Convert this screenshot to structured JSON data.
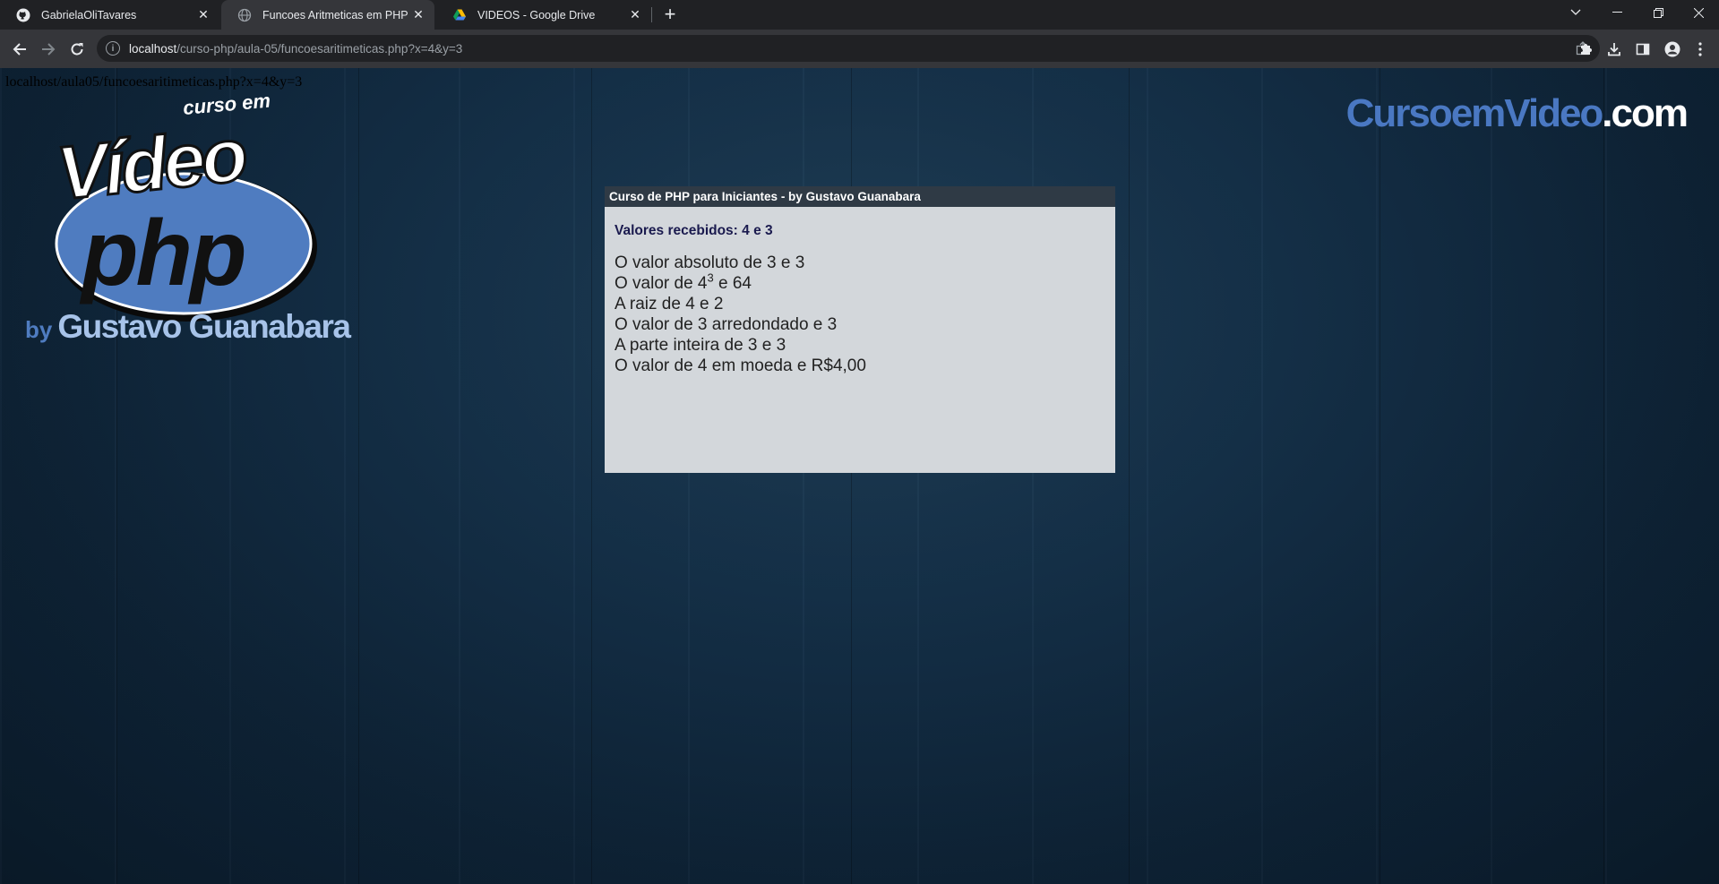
{
  "browser": {
    "tabs": [
      {
        "title": "GabrielaOliTavares",
        "icon": "github-icon",
        "active": false
      },
      {
        "title": "Funcoes Aritmeticas em PHP",
        "icon": "globe-icon",
        "active": true
      },
      {
        "title": "VIDEOS - Google Drive",
        "icon": "google-drive-icon",
        "active": false
      }
    ],
    "url_host": "localhost",
    "url_path": "/curso-php/aula-05/funcoesaritimeticas.php?x=4&y=3"
  },
  "page": {
    "echo_url": "localhost/aula05/funcoesaritimeticas.php?x=4&y=3",
    "logo_top_text": "curso em",
    "logo_video_text": "Vídeo",
    "logo_php_text": "php",
    "byline_by": "by",
    "byline_name": "Gustavo Guanabara",
    "brand_part1": "CursoemVideo",
    "brand_part2": ".com",
    "panel": {
      "header": "Curso de PHP para Iniciantes - by Gustavo Guanabara",
      "received": "Valores recebidos: 4 e 3",
      "line1": "O valor absoluto de 3 e 3",
      "line2_prefix": "O valor de 4",
      "line2_sup": "3",
      "line2_suffix": " e 64",
      "line3": "A raiz de 4 e 2",
      "line4": "O valor de 3 arredondado e 3",
      "line5": "A parte inteira de 3 e 3",
      "line6": "O valor de 4 em moeda e R$4,00"
    }
  },
  "colors": {
    "panel_bg": "#d3d7db",
    "panel_header": "#2f3a45",
    "brand_blue": "#4a78c2"
  }
}
